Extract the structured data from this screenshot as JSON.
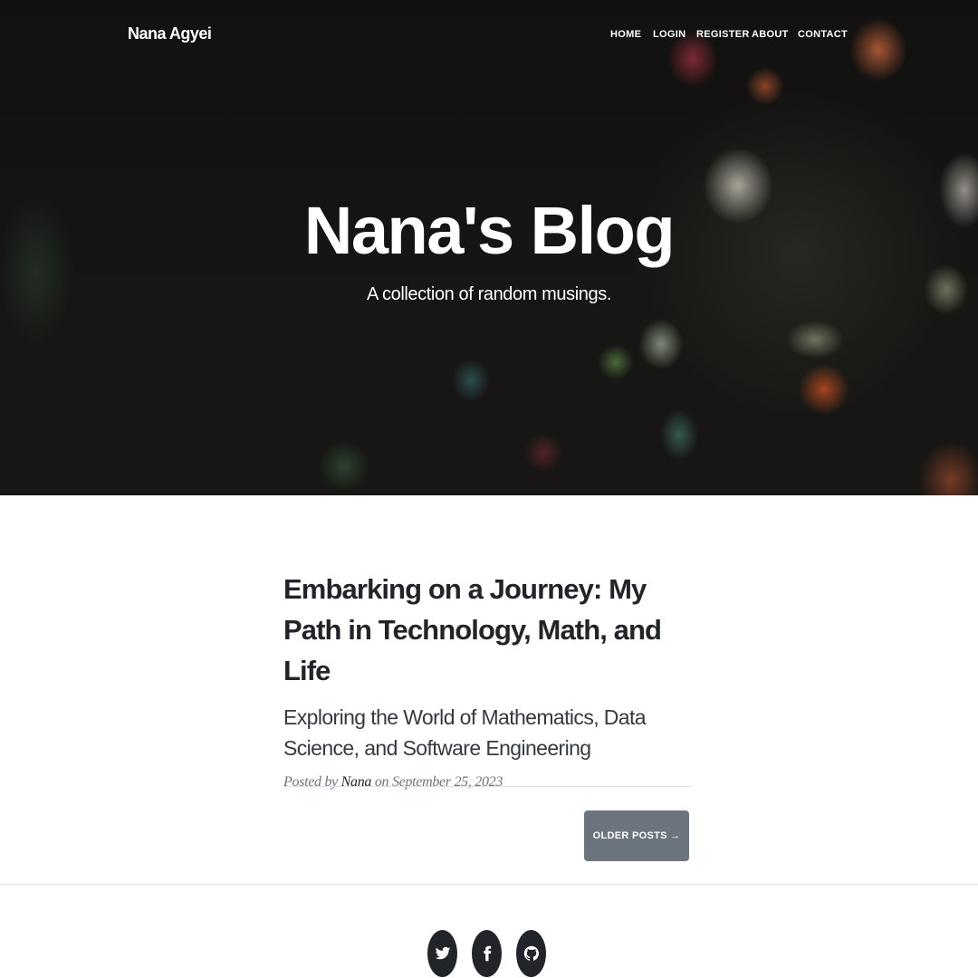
{
  "nav": {
    "brand": "Nana Agyei",
    "links": [
      "HOME",
      "LOGIN",
      "REGISTER",
      "ABOUT",
      "CONTACT"
    ]
  },
  "hero": {
    "title": "Nana's Blog",
    "subtitle": "A collection of random musings."
  },
  "post": {
    "title": "Embarking on a Journey: My Path in Technology, Math, and Life",
    "subtitle": "Exploring the World of Mathematics, Data Science, and Software Engineering",
    "meta_prefix": "Posted by",
    "author": "Nana",
    "meta_suffix": "on September 25, 2023"
  },
  "pager": {
    "older_label": "OLDER POSTS →"
  },
  "footer": {
    "social": [
      {
        "icon": "twitter-icon"
      },
      {
        "icon": "facebook-icon"
      },
      {
        "icon": "github-icon"
      }
    ]
  },
  "colors": {
    "button_bg": "#6c757d",
    "text_dark": "#212529",
    "meta_gray": "#6c757d"
  }
}
